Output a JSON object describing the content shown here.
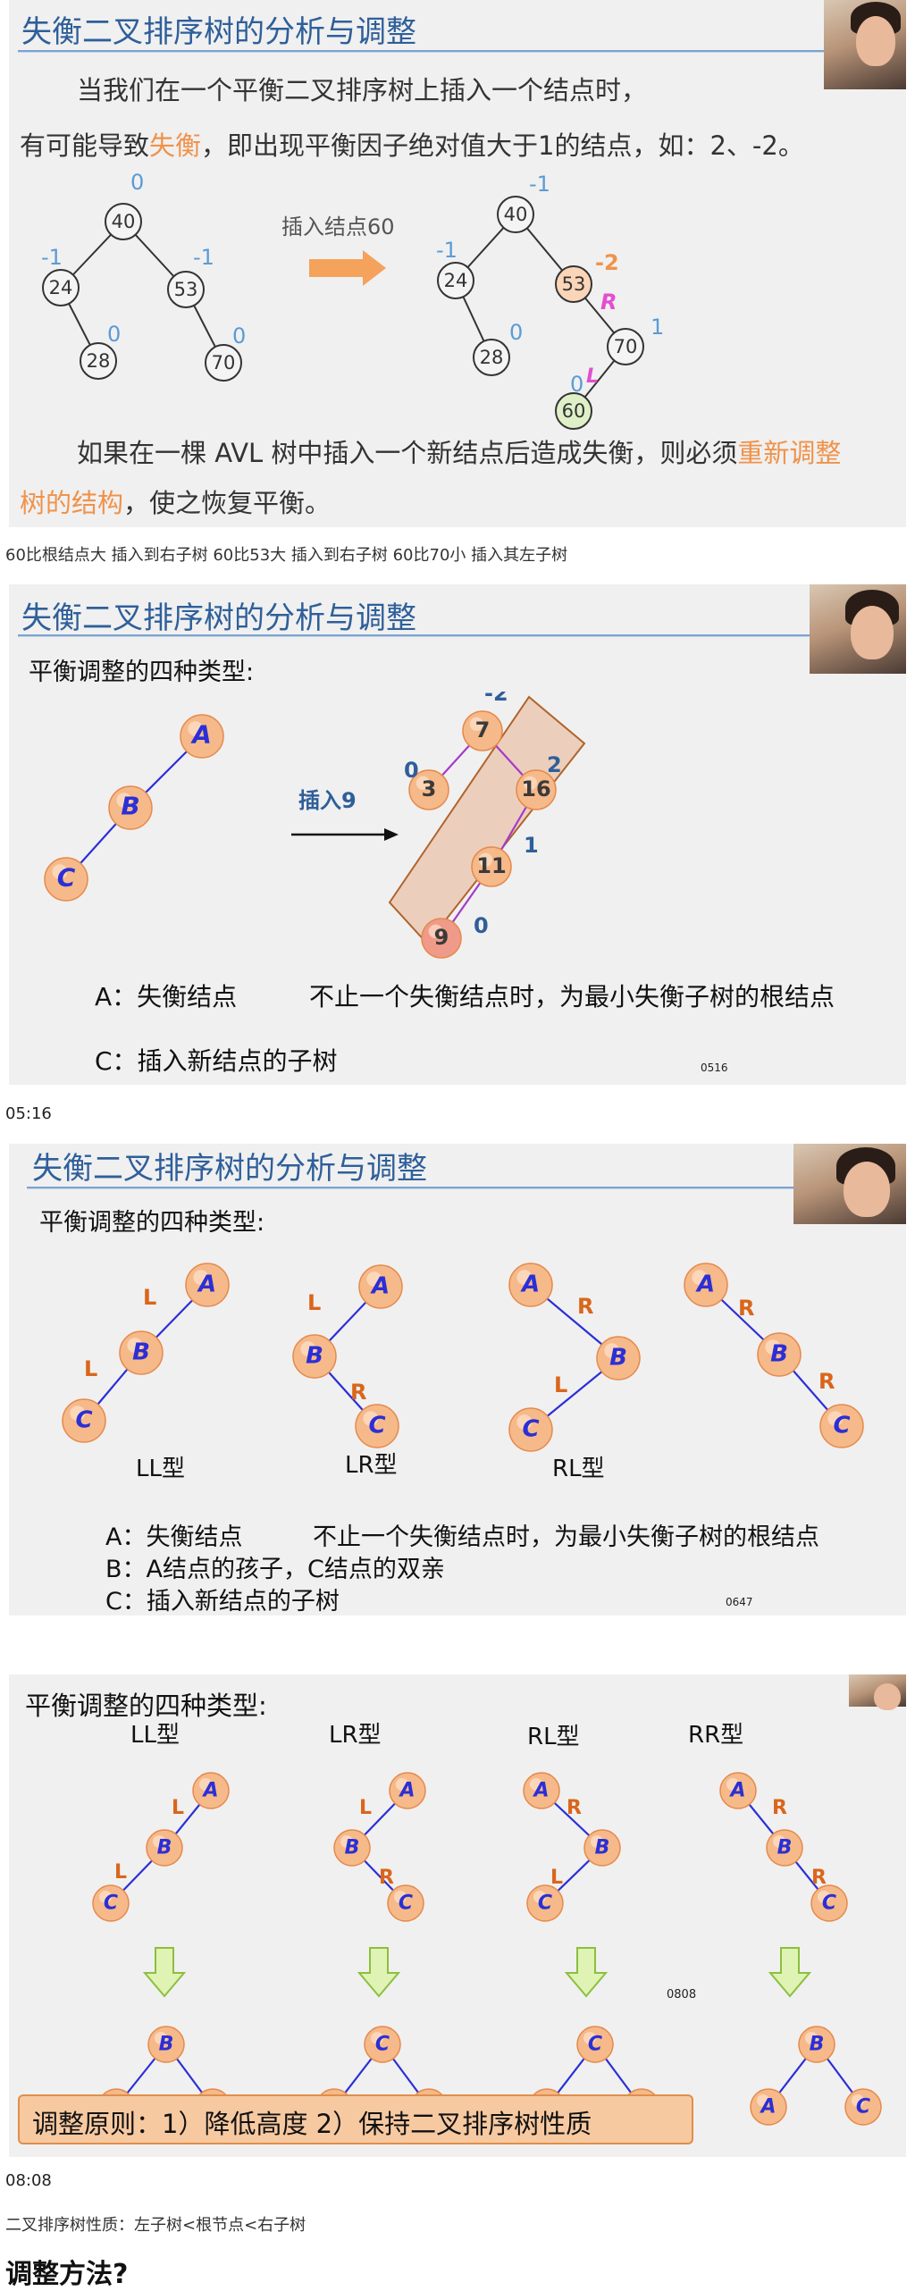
{
  "slide1": {
    "title": "失衡二叉排序树的分析与调整",
    "line1": "当我们在一个平衡二叉排序树上插入一个结点时，",
    "line2_pre": "有可能导致",
    "line2_hl": "失衡",
    "line2_post": "，即出现平衡因子绝对值大于1的结点，如：2、-2。",
    "insert_label": "插入结点60",
    "left_tree": {
      "nodes": [
        "40",
        "24",
        "53",
        "28",
        "70"
      ],
      "factors": [
        "0",
        "-1",
        "-1",
        "0",
        "0"
      ]
    },
    "right_tree": {
      "nodes": [
        "40",
        "24",
        "53",
        "28",
        "70",
        "60"
      ],
      "factors": [
        "-1",
        "-1",
        "-2",
        "0",
        "1",
        "0"
      ],
      "marks": [
        "R",
        "L"
      ]
    },
    "para_pre": "如果在一棵 AVL 树中插入一个新结点后造成失衡，则必须",
    "para_hl1": "重新调整",
    "para_hl2": "树的结构",
    "para_post": "，使之恢复平衡。"
  },
  "caption1": "60比根结点大 插入到右子树 60比53大 插入到右子树 60比70小 插入其左子树",
  "slide2": {
    "title": "失衡二叉排序树的分析与调整",
    "heading": "平衡调整的四种类型:",
    "abc": [
      "A",
      "B",
      "C"
    ],
    "insert_label": "插入9",
    "nodes": [
      "7",
      "3",
      "16",
      "11",
      "9"
    ],
    "factors": [
      "-2",
      "0",
      "2",
      "1",
      "0"
    ],
    "def_a": "A：失衡结点",
    "def_a_note": "不止一个失衡结点时，为最小失衡子树的根结点",
    "def_c": "C：插入新结点的子树",
    "stamp": "0516"
  },
  "timestamp1": "05:16",
  "slide3": {
    "title": "失衡二叉排序树的分析与调整",
    "heading": "平衡调整的四种类型:",
    "types": [
      "LL型",
      "LR型",
      "RL型"
    ],
    "edge_labels": {
      "L": "L",
      "R": "R"
    },
    "def_a": "A：失衡结点",
    "def_a_note": "不止一个失衡结点时，为最小失衡子树的根结点",
    "def_b": "B：A结点的孩子，C结点的双亲",
    "def_c": "C：插入新结点的子树",
    "stamp": "0647"
  },
  "slide4": {
    "heading": "平衡调整的四种类型:",
    "types": [
      "LL型",
      "LR型",
      "RL型",
      "RR型"
    ],
    "principle": "调整原则：1）降低高度   2）保持二叉排序树性质",
    "stamp": "0808"
  },
  "timestamp2": "08:08",
  "caption2": "二叉排序树性质：左子树<根节点<右子树",
  "heading_bottom": "调整方法?",
  "colors": {
    "title": "#2f5f9a",
    "accent": "#f0924a",
    "factor": "#5b9bd5",
    "node_fill": "#f6b98a",
    "letter": "#2b2fd6",
    "edge": "#2b2fd6",
    "edge_label": "#d9661c",
    "purple": "#a23cc9"
  }
}
